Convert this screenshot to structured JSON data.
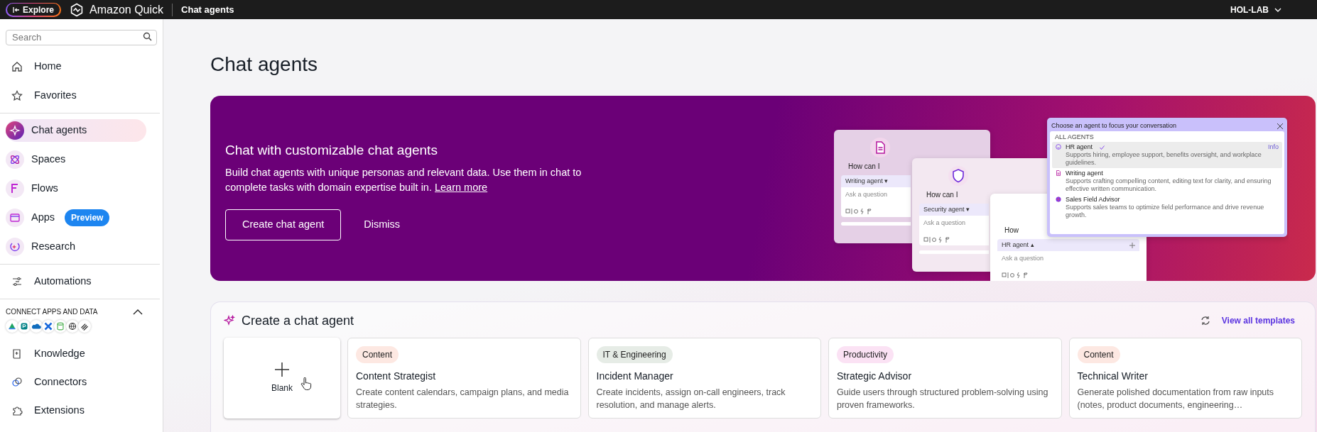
{
  "top_bar": {
    "explore_button": "Explore",
    "brand": "Amazon Quick",
    "page": "Chat agents",
    "account": "HOL-LAB"
  },
  "sidebar": {
    "search": {
      "placeholder": "Search"
    },
    "sections": [
      {
        "items": [
          {
            "label": "Home",
            "kind": "link",
            "selected": false
          },
          {
            "label": "Favorites",
            "kind": "link",
            "selected": false
          }
        ]
      },
      {
        "items": [
          {
            "label": "Chat agents",
            "kind": "app",
            "selected": true
          },
          {
            "label": "Spaces",
            "kind": "app",
            "selected": false
          },
          {
            "label": "Flows",
            "kind": "app",
            "selected": false
          },
          {
            "label": "Apps",
            "kind": "app",
            "selected": false,
            "badge": "Preview"
          },
          {
            "label": "Research",
            "kind": "app",
            "selected": false
          }
        ]
      },
      {
        "items": [
          {
            "label": "Automations",
            "kind": "link",
            "selected": false
          }
        ]
      }
    ],
    "connect": {
      "title": "CONNECT APPS AND DATA",
      "expanded": true
    },
    "bottom_items": [
      {
        "label": "Knowledge",
        "selected": false
      },
      {
        "label": "Connectors",
        "selected": false
      },
      {
        "label": "Extensions",
        "selected": false
      }
    ]
  },
  "main": {
    "title": "Chat agents",
    "banner": {
      "title": "Chat with customizable chat agents",
      "description": "Build chat agents with unique personas and relevant data. Use them in chat to complete tasks with domain expertise built in.",
      "link": "Learn more",
      "primary_button": "Create chat agent",
      "secondary_button": "Dismiss",
      "illustration": {
        "cards": [
          {
            "heading": "How can I",
            "agent": "Writing agent ▾",
            "placeholder": "Ask a question"
          },
          {
            "heading": "How can I",
            "agent": "Security agent ▾",
            "placeholder": "Ask a question"
          },
          {
            "heading": "How",
            "agent": "HR agent ▴",
            "placeholder": "Ask a question"
          }
        ],
        "popup": {
          "title": "Choose an agent to focus your conversation",
          "section": "ALL AGENTS",
          "agents": [
            {
              "name": "HR agent",
              "description": "Supports hiring, employee support, benefits oversight, and workplace guidelines.",
              "selected": true,
              "info": "Info"
            },
            {
              "name": "Writing agent",
              "description": "Supports crafting compelling content, editing text for clarity, and ensuring effective written communication.",
              "selected": false
            },
            {
              "name": "Sales Field Advisor",
              "description": "Supports sales teams to optimize field performance and drive revenue growth.",
              "selected": false
            }
          ]
        }
      }
    },
    "create_section": {
      "title": "Create a chat agent",
      "link": "View all templates",
      "blank_card": "Blank",
      "templates": [
        {
          "tag": "Content",
          "color": "#fde8e2",
          "name": "Content Strategist",
          "description": "Create content calendars, campaign plans, and media strategies."
        },
        {
          "tag": "IT & Engineering",
          "color": "#e6ece6",
          "name": "Incident Manager",
          "description": "Create incidents, assign on-call engineers, track resolution, and manage alerts."
        },
        {
          "tag": "Productivity",
          "color": "#fbe2f4",
          "name": "Strategic Advisor",
          "description": "Guide users through structured problem-solving using proven frameworks."
        },
        {
          "tag": "Content",
          "color": "#fde8e2",
          "name": "Technical Writer",
          "description": "Generate polished documentation from raw inputs (notes, product documents, engineering…"
        }
      ]
    }
  }
}
